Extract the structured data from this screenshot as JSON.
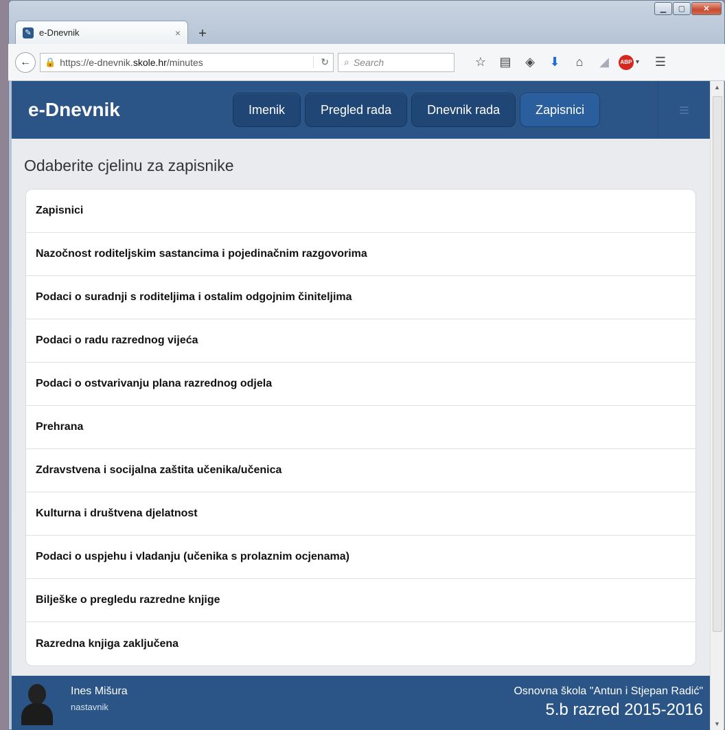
{
  "browser": {
    "tab_title": "e-Dnevnik",
    "url_prefix": "https://e-dnevnik.",
    "url_domain": "skole.hr",
    "url_path": "/minutes",
    "search_placeholder": "Search"
  },
  "app": {
    "brand": "e-Dnevnik",
    "nav": [
      {
        "label": "Imenik"
      },
      {
        "label": "Pregled rada"
      },
      {
        "label": "Dnevnik rada"
      },
      {
        "label": "Zapisnici"
      }
    ],
    "page_title": "Odaberite cjelinu za zapisnike",
    "items": [
      "Zapisnici",
      "Nazočnost roditeljskim sastancima i pojedinačnim razgovorima",
      "Podaci o suradnji s roditeljima i ostalim odgojnim činiteljima",
      "Podaci o radu razrednog vijeća",
      "Podaci o ostvarivanju plana razrednog odjela",
      "Prehrana",
      "Zdravstvena i socijalna zaštita učenika/učenica",
      "Kulturna i društvena djelatnost",
      "Podaci o uspjehu i vladanju (učenika s prolaznim ocjenama)",
      "Bilješke o pregledu razredne knjige",
      "Razredna knjiga zaključena"
    ],
    "footer": {
      "user_name": "Ines Mišura",
      "user_role": "nastavnik",
      "school": "Osnovna škola \"Antun i Stjepan Radić\"",
      "class_year": "5.b razred 2015-2016"
    }
  }
}
